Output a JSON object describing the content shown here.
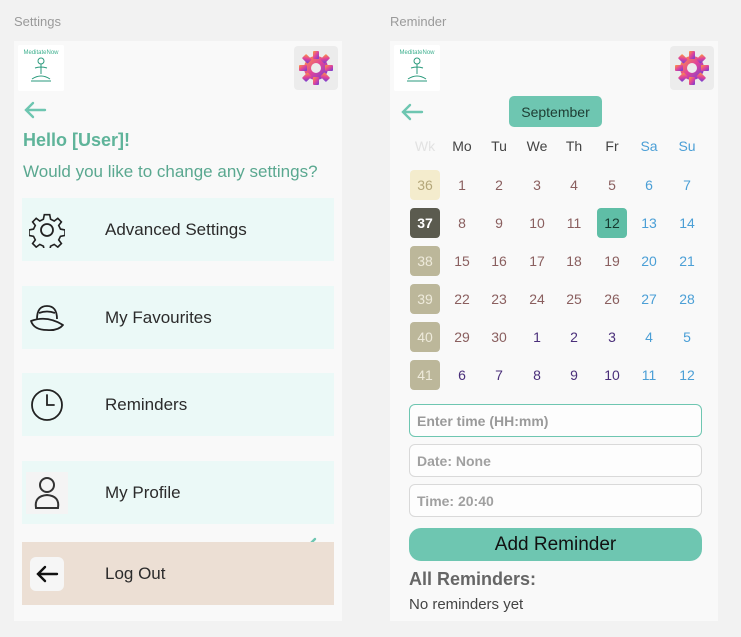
{
  "frames": {
    "settings_label": "Settings",
    "reminder_label": "Reminder"
  },
  "logo_text": "MeditateNow",
  "settings": {
    "greeting": "Hello [User]!",
    "question": "Would you like to change any settings?",
    "menu": [
      {
        "label": "Advanced Settings",
        "icon": "gear-icon"
      },
      {
        "label": "My Favourites",
        "icon": "hat-icon"
      },
      {
        "label": "Reminders",
        "icon": "clock-icon"
      },
      {
        "label": "My Profile",
        "icon": "user-icon"
      },
      {
        "label": "Log Out",
        "icon": "arrow-left-icon"
      }
    ]
  },
  "reminder": {
    "month": "September",
    "week_header": "Wk",
    "weekdays": [
      "Mo",
      "Tu",
      "We",
      "Th",
      "Fr",
      "Sa",
      "Su"
    ],
    "weeks": [
      {
        "wk": "36",
        "days": [
          "1",
          "2",
          "3",
          "4",
          "5",
          "6",
          "7"
        ]
      },
      {
        "wk": "37",
        "days": [
          "8",
          "9",
          "10",
          "11",
          "12",
          "13",
          "14"
        ]
      },
      {
        "wk": "38",
        "days": [
          "15",
          "16",
          "17",
          "18",
          "19",
          "20",
          "21"
        ]
      },
      {
        "wk": "39",
        "days": [
          "22",
          "23",
          "24",
          "25",
          "26",
          "27",
          "28"
        ]
      },
      {
        "wk": "40",
        "days": [
          "29",
          "30",
          "1",
          "2",
          "3",
          "4",
          "5"
        ]
      },
      {
        "wk": "41",
        "days": [
          "6",
          "7",
          "8",
          "9",
          "10",
          "11",
          "12"
        ]
      }
    ],
    "selected_day": "12",
    "time_placeholder": "Enter time (HH:mm)",
    "date_text": "Date: None",
    "time_text": "Time: 20:40",
    "add_button": "Add Reminder",
    "all_reminders_title": "All Reminders:",
    "empty_text": "No reminders yet"
  },
  "colors": {
    "accent": "#6ec6b1",
    "menu_bg": "#ebf9f7",
    "logout_bg": "#ecdfd4",
    "weekend": "#4b9fd6"
  }
}
